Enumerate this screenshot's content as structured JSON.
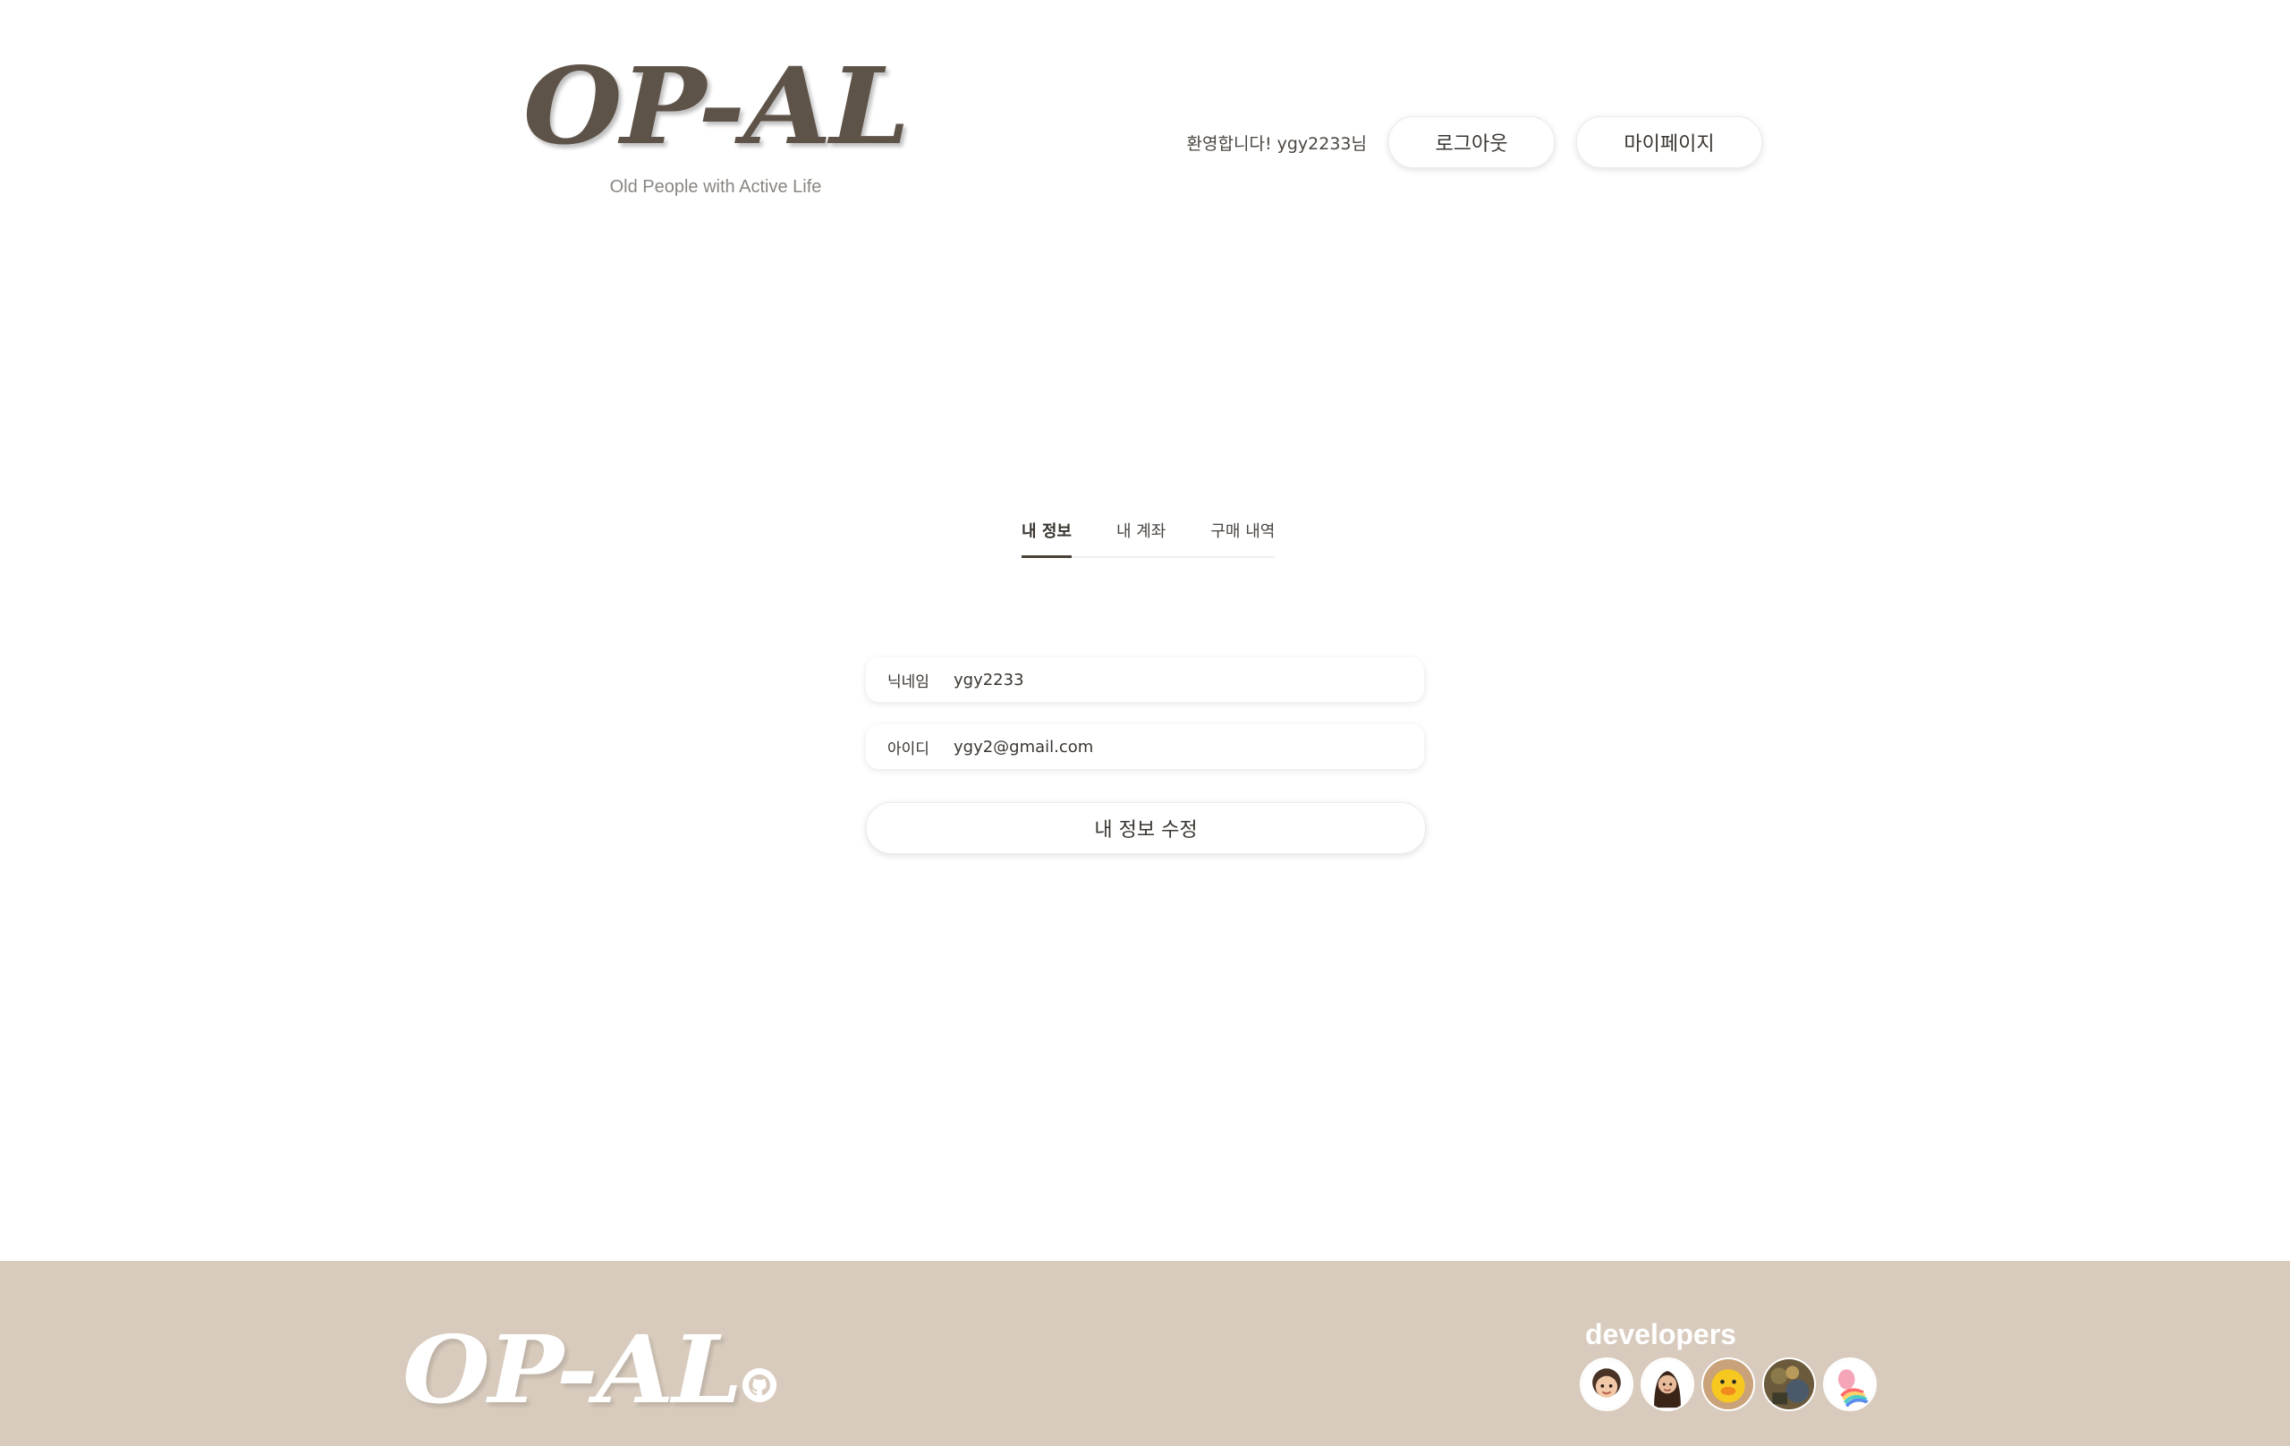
{
  "header": {
    "logo": "OP-AL",
    "tagline": "Old People with Active Life",
    "welcome": "환영합니다! ygy2233님",
    "logout_label": "로그아웃",
    "mypage_label": "마이페이지"
  },
  "tabs": [
    {
      "label": "내 정보",
      "active": true
    },
    {
      "label": "내 계좌",
      "active": false
    },
    {
      "label": "구매 내역",
      "active": false
    }
  ],
  "profile": {
    "nickname_label": "닉네임",
    "nickname_value": "ygy2233",
    "id_label": "아이디",
    "id_value": "ygy2@gmail.com",
    "edit_button_label": "내 정보 수정"
  },
  "footer": {
    "logo": "OP-AL",
    "github_icon": "github-icon",
    "developers_title": "developers",
    "background_color": "#d8cbbd"
  },
  "colors": {
    "logo_brown": "#5e5348",
    "text_dark": "#3a3530",
    "tab_underline": "#4a4038"
  }
}
